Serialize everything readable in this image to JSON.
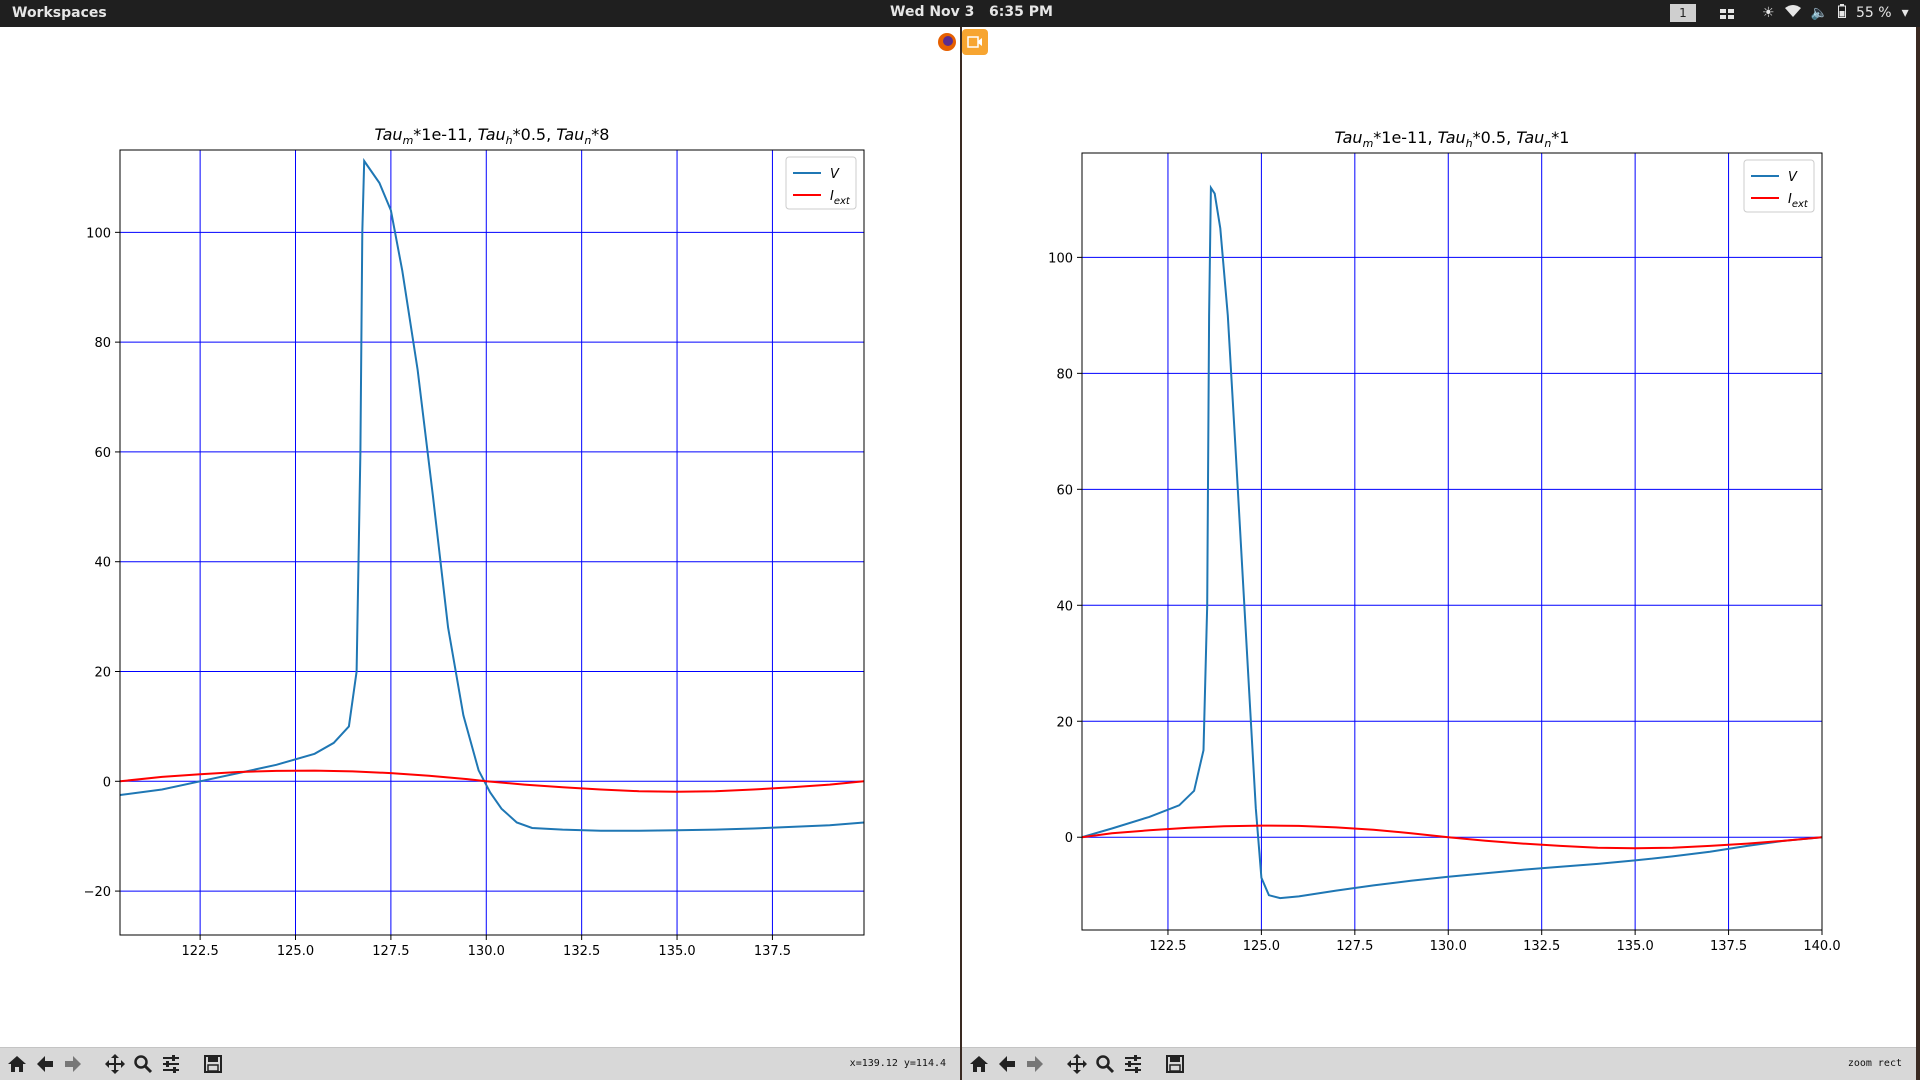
{
  "topbar": {
    "workspaces_label": "Workspaces",
    "datetime": "Wed Nov 3   6:35 PM",
    "workspace_number": "1",
    "battery": "55 %"
  },
  "windows": [
    {
      "toolbar_status": "x=139.12 y=114.4"
    },
    {
      "toolbar_status": "zoom rect"
    }
  ],
  "chart_data": [
    {
      "type": "line",
      "title": "Tau_m*1e-11, Tau_h*0.5, Tau_n*8",
      "title_parts": {
        "a": "Tau",
        "a_sub": "m",
        "b": "*1e-11, ",
        "c": "Tau",
        "c_sub": "h",
        "d": "*0.5, ",
        "e": "Tau",
        "e_sub": "n",
        "f": "*8"
      },
      "xlim": [
        120.4,
        139.9
      ],
      "ylim": [
        -28,
        115
      ],
      "xticks": [
        122.5,
        125.0,
        127.5,
        130.0,
        132.5,
        135.0,
        137.5
      ],
      "xtick_labels": [
        "122.5",
        "125.0",
        "127.5",
        "130.0",
        "132.5",
        "135.0",
        "137.5"
      ],
      "yticks": [
        -20,
        0,
        20,
        40,
        60,
        80,
        100
      ],
      "ytick_labels": [
        "−20",
        "0",
        "20",
        "40",
        "60",
        "80",
        "100"
      ],
      "grid": true,
      "grid_color": "#0000ff",
      "legend_position": "upper-right",
      "series": [
        {
          "name": "V",
          "color": "#1f77b4",
          "x": [
            120.4,
            121.5,
            122.5,
            123.5,
            124.5,
            125.5,
            126.0,
            126.4,
            126.6,
            126.7,
            126.75,
            126.8,
            126.9,
            127.2,
            127.5,
            127.8,
            128.2,
            128.6,
            129.0,
            129.4,
            129.8,
            130.1,
            130.4,
            130.8,
            131.2,
            132.0,
            133.0,
            134.0,
            135.0,
            136.0,
            137.0,
            138.0,
            139.0,
            139.9
          ],
          "y": [
            -2.5,
            -1.5,
            0,
            1.5,
            3,
            5,
            7,
            10,
            20,
            60,
            100,
            113,
            112,
            109,
            104,
            93,
            75,
            52,
            28,
            12,
            2,
            -2,
            -5,
            -7.5,
            -8.5,
            -8.8,
            -9,
            -9,
            -8.9,
            -8.8,
            -8.6,
            -8.3,
            -8,
            -7.5
          ]
        },
        {
          "name": "I_ext",
          "color": "#ff0000",
          "x": [
            120.4,
            121.5,
            122.5,
            123.5,
            124.5,
            125.5,
            126.5,
            127.5,
            128.5,
            129.5,
            130.0,
            131.0,
            132.0,
            133.0,
            134.0,
            135.0,
            136.0,
            137.0,
            138.0,
            139.0,
            139.9
          ],
          "y": [
            0,
            0.8,
            1.3,
            1.7,
            1.9,
            1.95,
            1.8,
            1.5,
            1.0,
            0.4,
            0.0,
            -0.6,
            -1.1,
            -1.5,
            -1.8,
            -1.9,
            -1.8,
            -1.5,
            -1.1,
            -0.6,
            0.0
          ]
        }
      ]
    },
    {
      "type": "line",
      "title": "Tau_m*1e-11, Tau_h*0.5, Tau_n*1",
      "title_parts": {
        "a": "Tau",
        "a_sub": "m",
        "b": "*1e-11, ",
        "c": "Tau",
        "c_sub": "h",
        "d": "*0.5, ",
        "e": "Tau",
        "e_sub": "n",
        "f": "*1"
      },
      "xlim": [
        120.2,
        140.0
      ],
      "ylim": [
        -16,
        118
      ],
      "xticks": [
        122.5,
        125.0,
        127.5,
        130.0,
        132.5,
        135.0,
        137.5,
        140.0
      ],
      "xtick_labels": [
        "122.5",
        "125.0",
        "127.5",
        "130.0",
        "132.5",
        "135.0",
        "137.5",
        "140.0"
      ],
      "yticks": [
        0,
        20,
        40,
        60,
        80,
        100
      ],
      "ytick_labels": [
        "0",
        "20",
        "40",
        "60",
        "80",
        "100"
      ],
      "grid": true,
      "grid_color": "#0000ff",
      "legend_position": "upper-right",
      "series": [
        {
          "name": "V",
          "color": "#1f77b4",
          "x": [
            120.2,
            121.0,
            122.0,
            122.8,
            123.2,
            123.45,
            123.55,
            123.6,
            123.65,
            123.75,
            123.9,
            124.1,
            124.3,
            124.5,
            124.7,
            124.85,
            125.0,
            125.2,
            125.5,
            126.0,
            127.0,
            128.0,
            129.0,
            130.0,
            131.0,
            132.0,
            133.0,
            134.0,
            135.0,
            136.0,
            137.0,
            138.0,
            139.0,
            140.0
          ],
          "y": [
            0,
            1.5,
            3.5,
            5.5,
            8,
            15,
            40,
            90,
            112,
            111,
            105,
            90,
            68,
            45,
            22,
            5,
            -7,
            -10,
            -10.5,
            -10.2,
            -9.2,
            -8.3,
            -7.5,
            -6.8,
            -6.2,
            -5.6,
            -5.1,
            -4.6,
            -4.0,
            -3.3,
            -2.5,
            -1.5,
            -0.6,
            0.0
          ]
        },
        {
          "name": "I_ext",
          "color": "#ff0000",
          "x": [
            120.2,
            121.0,
            122.0,
            123.0,
            124.0,
            125.0,
            126.0,
            127.0,
            128.0,
            129.0,
            130.0,
            131.0,
            132.0,
            133.0,
            134.0,
            135.0,
            136.0,
            137.0,
            138.0,
            139.0,
            140.0
          ],
          "y": [
            0,
            0.7,
            1.2,
            1.6,
            1.9,
            2.0,
            1.95,
            1.7,
            1.3,
            0.7,
            0.0,
            -0.6,
            -1.1,
            -1.5,
            -1.8,
            -1.9,
            -1.8,
            -1.5,
            -1.1,
            -0.6,
            0.0
          ]
        }
      ]
    }
  ]
}
